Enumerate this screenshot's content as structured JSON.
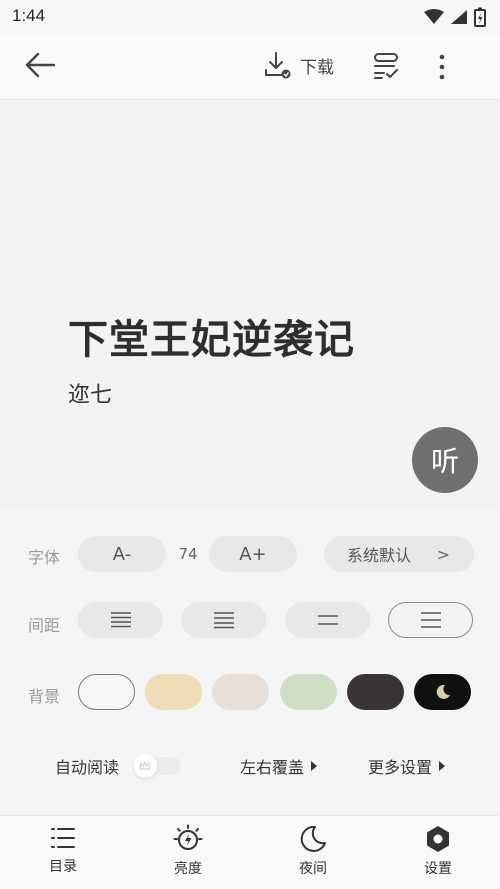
{
  "status": {
    "time": "1:44"
  },
  "toolbar": {
    "download_label": "下载"
  },
  "book": {
    "title": "下堂王妃逆袭记",
    "author": "迩七",
    "listen_label": "听"
  },
  "settings": {
    "font": {
      "label": "字体",
      "decrease": "A-",
      "size": "74",
      "increase": "A+",
      "family": "系统默认",
      "family_arrow": ">"
    },
    "spacing": {
      "label": "间距"
    },
    "background": {
      "label": "背景",
      "colors": [
        "#f7f7f7",
        "#efdcb8",
        "#e8e0d8",
        "#cfdfc6",
        "#3a3434",
        "#101010"
      ]
    },
    "auto_read": "自动阅读",
    "page_turn": "左右覆盖",
    "more": "更多设置"
  },
  "nav": {
    "catalog": "目录",
    "brightness": "亮度",
    "night": "夜间",
    "settings": "设置"
  }
}
